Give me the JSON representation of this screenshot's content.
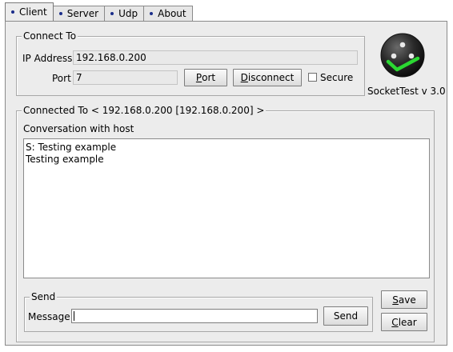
{
  "tabs": [
    {
      "label": "Client",
      "active": true
    },
    {
      "label": "Server",
      "active": false
    },
    {
      "label": "Udp",
      "active": false
    },
    {
      "label": "About",
      "active": false
    }
  ],
  "connect": {
    "group_title": "Connect To",
    "ip_label": "IP Address",
    "ip_value": "192.168.0.200",
    "port_label": "Port",
    "port_value": "7",
    "port_button": {
      "pre": "",
      "mnemonic": "P",
      "post": "ort"
    },
    "disconnect_button": {
      "pre": "",
      "mnemonic": "D",
      "post": "isconnect"
    },
    "secure_label": "Secure",
    "secure_checked": false
  },
  "branding": {
    "product": "SocketTest v 3.0",
    "logo_icon": "socket-check-logo-icon",
    "accent_color": "#2bd832"
  },
  "connected": {
    "group_title": "Connected To <  192.168.0.200 [192.168.0.200]  >",
    "conversation_label": "Conversation with host",
    "conversation_text": "S: Testing example\nTesting example"
  },
  "send": {
    "group_title": "Send",
    "message_label": "Message",
    "message_value": "",
    "send_button": "Send"
  },
  "side_buttons": {
    "save": {
      "pre": "",
      "mnemonic": "S",
      "post": "ave"
    },
    "clear": {
      "pre": "",
      "mnemonic": "C",
      "post": "lear"
    }
  }
}
